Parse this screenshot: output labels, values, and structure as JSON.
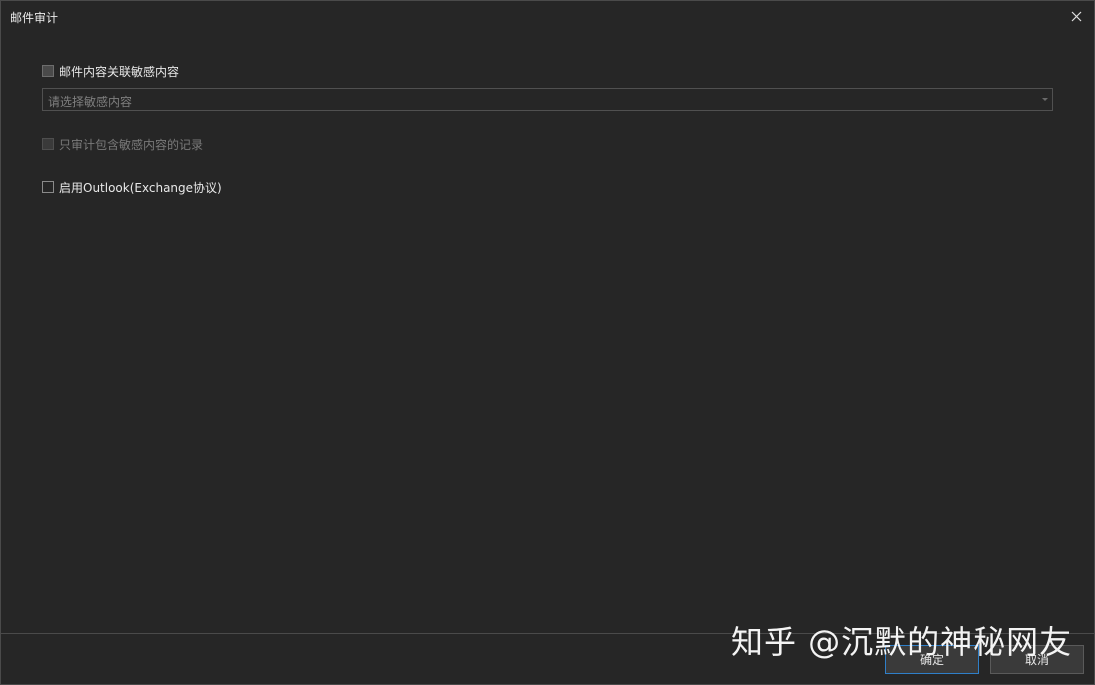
{
  "dialog": {
    "title": "邮件审计"
  },
  "options": {
    "link_sensitive": {
      "label": "邮件内容关联敏感内容",
      "checked": false
    },
    "sensitive_select": {
      "placeholder": "请选择敏感内容"
    },
    "audit_only_sensitive": {
      "label": "只审计包含敏感内容的记录",
      "checked": false,
      "disabled": true
    },
    "enable_outlook": {
      "label": "启用Outlook(Exchange协议)",
      "checked": false
    }
  },
  "footer": {
    "ok_label": "确定",
    "cancel_label": "取消"
  },
  "watermark": {
    "text": "知乎 @沉默的神秘网友"
  },
  "colors": {
    "background": "#262626",
    "accent_border": "#2f7fc8"
  },
  "icons": {
    "close": "close-icon",
    "dropdown": "chevron-down-icon"
  }
}
